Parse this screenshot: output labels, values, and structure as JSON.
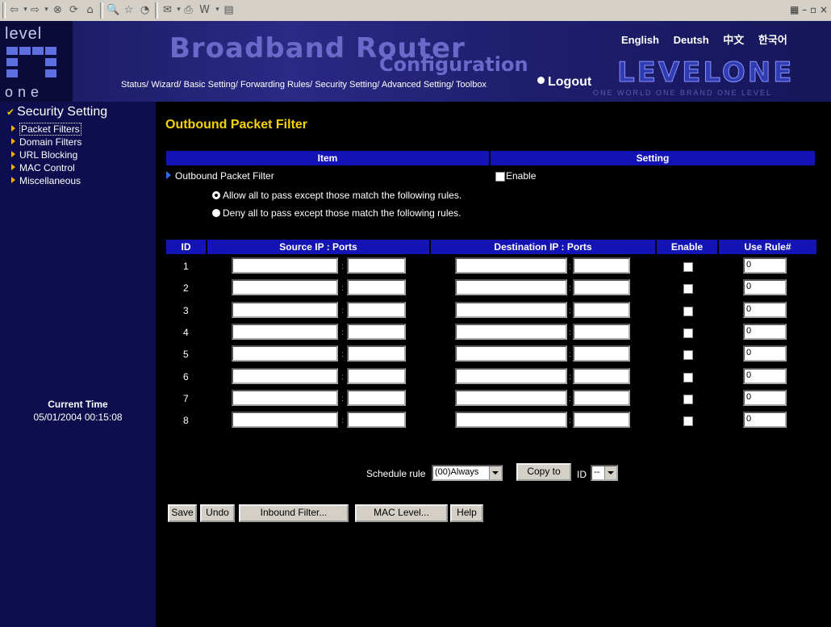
{
  "toolbar": {
    "icons": [
      "back-icon",
      "dropdown-icon",
      "forward-icon",
      "dropdown-icon",
      "stop-icon",
      "refresh-icon",
      "home-icon",
      "search-icon",
      "favorites-icon",
      "history-icon",
      "mail-icon",
      "print-icon",
      "word-icon",
      "dropdown-icon",
      "discuss-icon"
    ]
  },
  "header": {
    "logo_top": "level",
    "logo_bottom": "one",
    "title_line1": "Broadband Router",
    "title_line2": "Configuration",
    "languages": [
      "English",
      "Deutsh",
      "中文",
      "한국어"
    ],
    "brand": "LEVELONE",
    "motto": "ONE WORLD  ONE BRAND  ONE LEVEL",
    "nav": [
      "Status/",
      "Wizard/",
      "Basic Setting/",
      "Forwarding Rules/",
      "Security Setting/",
      "Advanced Setting/",
      "Toolbox"
    ],
    "logout": "Logout"
  },
  "sidebar": {
    "title": "Security Setting",
    "items": [
      {
        "label": "Packet Filters",
        "active": true
      },
      {
        "label": "Domain Filters"
      },
      {
        "label": "URL Blocking"
      },
      {
        "label": "MAC Control"
      },
      {
        "label": "Miscellaneous"
      }
    ],
    "current_time_label": "Current Time",
    "current_time_value": "05/01/2004 00:15:08"
  },
  "main": {
    "title": "Outbound Packet Filter",
    "header_item": "Item",
    "header_setting": "Setting",
    "filter_label": "Outbound Packet Filter",
    "enable_label": "Enable",
    "radio_allow": "Allow all to pass except those match the following rules.",
    "radio_deny": "Deny all to pass except those match the following rules.",
    "table": {
      "headers": [
        "ID",
        "Source IP : Ports",
        "Destination IP : Ports",
        "Enable",
        "Use Rule#"
      ],
      "rows": [
        {
          "id": "1",
          "use_rule": "0"
        },
        {
          "id": "2",
          "use_rule": "0"
        },
        {
          "id": "3",
          "use_rule": "0"
        },
        {
          "id": "4",
          "use_rule": "0"
        },
        {
          "id": "5",
          "use_rule": "0"
        },
        {
          "id": "6",
          "use_rule": "0"
        },
        {
          "id": "7",
          "use_rule": "0"
        },
        {
          "id": "8",
          "use_rule": "0"
        }
      ]
    },
    "schedule_label": "Schedule rule",
    "schedule_value": "(00)Always",
    "copy_button": "Copy to",
    "id_label": "ID",
    "id_value": "--",
    "buttons": [
      "Save",
      "Undo",
      "Inbound Filter...",
      "MAC Level...",
      "Help"
    ]
  }
}
